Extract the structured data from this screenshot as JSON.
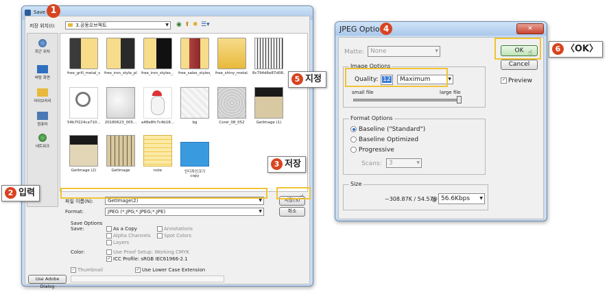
{
  "save_as": {
    "title": "Save As",
    "save_in_label": "저장 위치(I):",
    "save_in_value": "3.공동오브젝트",
    "sidebar": [
      {
        "label": "최근 위치",
        "icon": "recent-places-icon"
      },
      {
        "label": "바탕 화면",
        "icon": "desktop-icon"
      },
      {
        "label": "라이브러리",
        "icon": "libraries-icon"
      },
      {
        "label": "컴퓨터",
        "icon": "computer-icon"
      },
      {
        "label": "네트워크",
        "icon": "network-icon"
      }
    ],
    "files": [
      {
        "name": "free_grill_metal_s..."
      },
      {
        "name": "free_iron_style_pl..."
      },
      {
        "name": "free_iron_styles_..."
      },
      {
        "name": "free_sales_styles_..."
      },
      {
        "name": "free_shiny_metal..."
      },
      {
        "name": "8c794d6e87d08..."
      },
      {
        "name": "54b7f224ca710..."
      },
      {
        "name": "20180623_005..."
      },
      {
        "name": "a48e8fc7c4b18..."
      },
      {
        "name": "bg"
      },
      {
        "name": "Corel_08_052"
      },
      {
        "name": "GetImage (1)"
      },
      {
        "name": "GetImage (2)"
      },
      {
        "name": "GetImage"
      },
      {
        "name": "note"
      },
      {
        "name": "인디자인크기\ncopy"
      }
    ],
    "filename_label": "파일 이름(N):",
    "filename_value": "GetImage(2)",
    "format_label": "Format:",
    "format_value": "JPEG (*.JPG;*.JPEG;*.JPE)",
    "save_button": "저장(S)",
    "cancel_button": "취소",
    "save_options_label": "Save Options",
    "save_label": "Save:",
    "as_copy": "As a Copy",
    "annotations": "Annotations",
    "alpha_channels": "Alpha Channels",
    "spot_colors": "Spot Colors",
    "layers": "Layers",
    "color_label": "Color:",
    "use_proof_setup": "Use Proof Setup:  Working CMYK",
    "icc_profile": "ICC Profile:  sRGB IEC61966-2.1",
    "thumbnail": "Thumbnail",
    "lower_case_ext": "Use Lower Case Extension",
    "adobe_dialog_button": "Use Adobe Dialog"
  },
  "jpeg_options": {
    "title": "JPEG Options",
    "close_glyph": "✕",
    "matte_label": "Matte:",
    "matte_value": "None",
    "image_options_label": "Image Options",
    "quality_label": "Quality:",
    "quality_value": "12",
    "quality_preset": "Maximum",
    "small_file": "small file",
    "large_file": "large file",
    "quality_slider_fraction": 1.0,
    "format_options_label": "Format Options",
    "baseline_standard": "Baseline (\"Standard\")",
    "baseline_optimized": "Baseline Optimized",
    "progressive": "Progressive",
    "scans_label": "Scans:",
    "scans_value": "3",
    "size_label": "Size",
    "size_value": "~308.87K / 54.57s",
    "at": "@",
    "speed_value": "56.6Kbps",
    "ok_button": "OK",
    "cancel_button": "Cancel",
    "preview_label": "Preview"
  },
  "callouts": {
    "c1": "1",
    "c2_num": "2",
    "c2_text": "입력",
    "c3_num": "3",
    "c3_text": "저장",
    "c4": "4",
    "c5_num": "5",
    "c5_text": "지정",
    "c6_num": "6",
    "c6_text": "〈OK〉"
  },
  "colors": {
    "callout": "#d9431f",
    "highlight": "#f1c232"
  }
}
